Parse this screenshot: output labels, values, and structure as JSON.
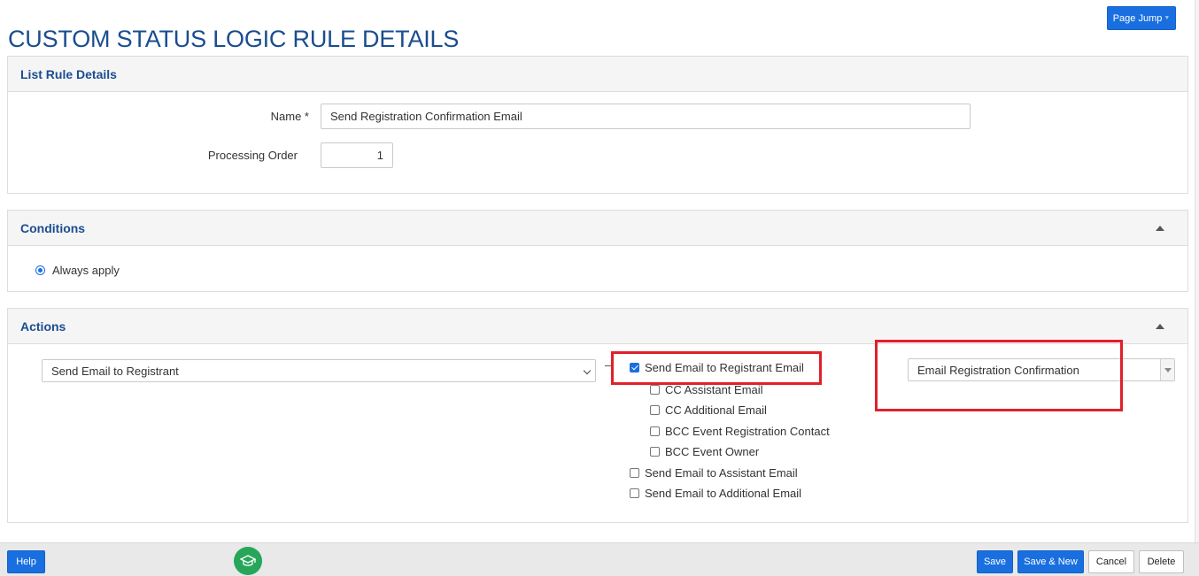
{
  "page": {
    "title": "CUSTOM STATUS LOGIC RULE DETAILS",
    "page_jump_label": "Page Jump"
  },
  "list_rule": {
    "heading": "List Rule Details",
    "name_label": "Name *",
    "name_value": "Send Registration Confirmation Email",
    "order_label": "Processing Order",
    "order_value": "1"
  },
  "conditions": {
    "heading": "Conditions",
    "option_label": "Always apply"
  },
  "actions": {
    "heading": "Actions",
    "action_select": "Send Email to Registrant",
    "template_select": "Email Registration Confirmation",
    "checkboxes": [
      {
        "label": "Send Email to Registrant Email",
        "checked": true
      },
      {
        "label": "CC Assistant Email",
        "checked": false
      },
      {
        "label": "CC Additional Email",
        "checked": false
      },
      {
        "label": "BCC Event Registration Contact",
        "checked": false
      },
      {
        "label": "BCC Event Owner",
        "checked": false
      },
      {
        "label": "Send Email to Assistant Email",
        "checked": false
      },
      {
        "label": "Send Email to Additional Email",
        "checked": false
      }
    ]
  },
  "footer": {
    "help_label": "Help",
    "save_label": "Save",
    "save_new_label": "Save & New",
    "cancel_label": "Cancel",
    "delete_label": "Delete"
  },
  "colors": {
    "accent": "#1a6fe0",
    "title": "#1a4d8f",
    "highlight": "#e0202a",
    "tutorial": "#27a65a"
  }
}
